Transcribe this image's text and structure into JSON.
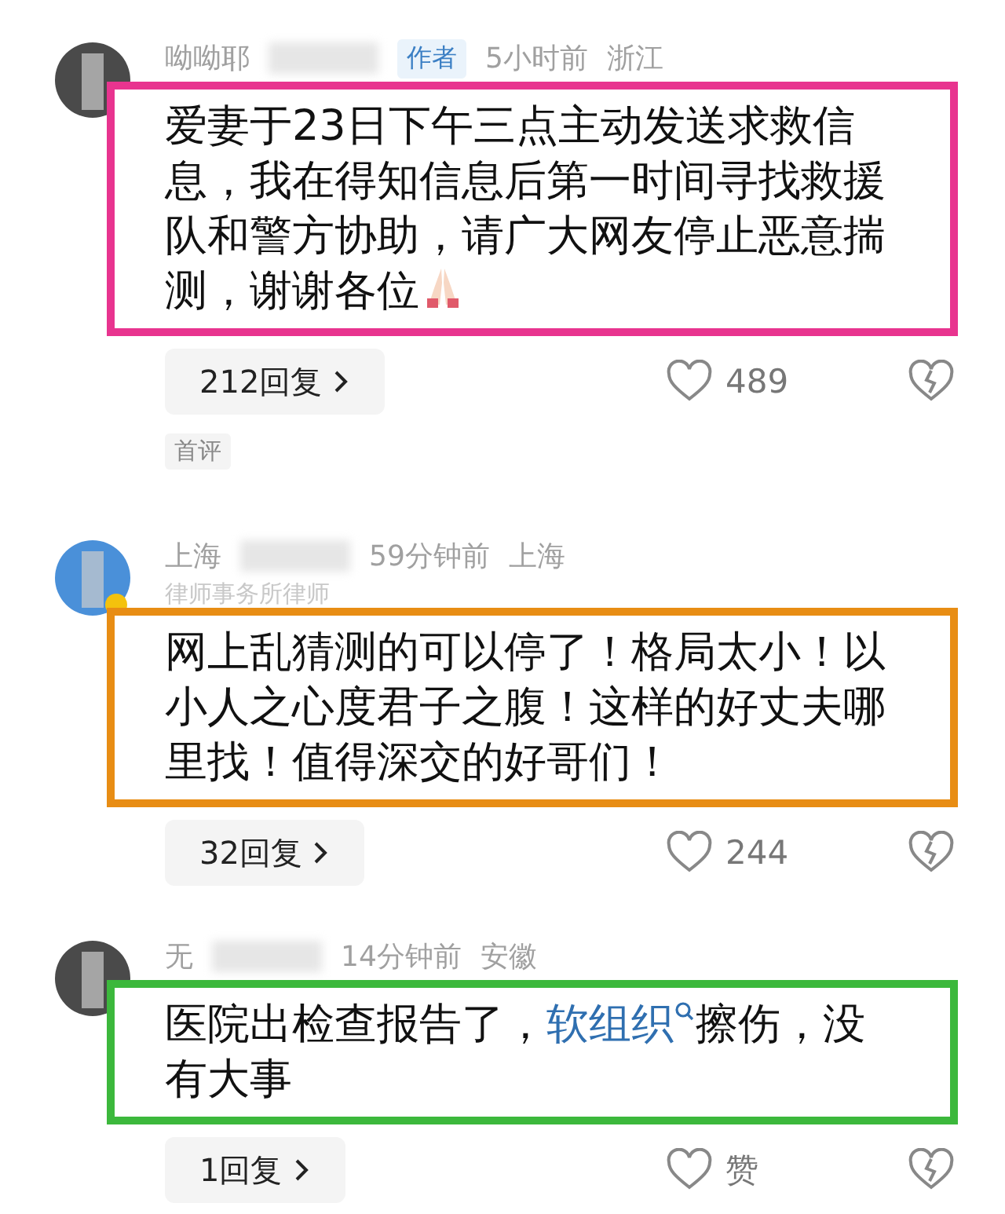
{
  "comments": [
    {
      "name": "呦呦耶",
      "author_badge": "作者",
      "time": "5小时前",
      "location": "浙江",
      "color": "#e8348f",
      "verified": false,
      "body": [
        {
          "kind": "text",
          "text": "爱妻于23日下午三点主动发送求救信息，我在得知信息后第一时间寻找救援队和警方协助，请广大网友停止恶意揣测，谢谢各位"
        },
        {
          "kind": "pray-emoji"
        }
      ],
      "replies": "212回复",
      "likes": "489",
      "tag": "首评"
    },
    {
      "name": "上海",
      "time": "59分钟前",
      "location": "上海",
      "subtitle": "律师事务所律师",
      "color": "#e88d14",
      "verified": true,
      "body": [
        {
          "kind": "text",
          "text": "网上乱猜测的可以停了！格局太小！以小人之心度君子之腹！这样的好丈夫哪里找！值得深交的好哥们！"
        }
      ],
      "replies": "32回复",
      "likes": "244"
    },
    {
      "name": "无",
      "time": "14分钟前",
      "location": "安徽",
      "color": "#3cb83c",
      "verified": false,
      "body": [
        {
          "kind": "text",
          "text": "医院出检查报告了，"
        },
        {
          "kind": "keyword",
          "text": "软组织"
        },
        {
          "kind": "text",
          "text": "擦伤，没有大事"
        }
      ],
      "replies": "1回复",
      "likes": "赞"
    }
  ]
}
